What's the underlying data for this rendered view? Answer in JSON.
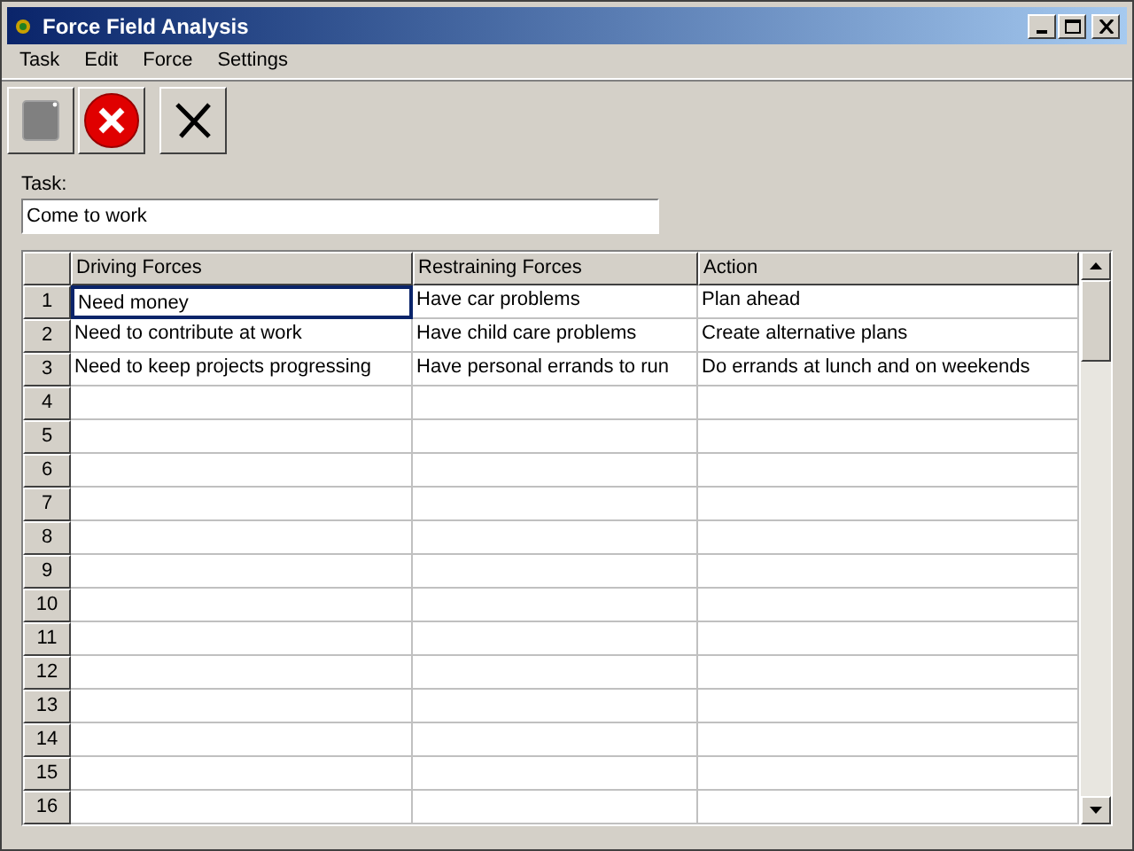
{
  "window": {
    "title": "Force Field Analysis"
  },
  "menu": [
    "Task",
    "Edit",
    "Force",
    "Settings"
  ],
  "task": {
    "label": "Task:",
    "value": "Come to work"
  },
  "table": {
    "columns": [
      "Driving Forces",
      "Restraining Forces",
      "Action"
    ],
    "rows": [
      {
        "number": "1",
        "cells": [
          {
            "text": "Need money",
            "selected": true
          },
          {
            "text": "Have car problems",
            "selected": false
          },
          {
            "text": "Plan ahead",
            "selected": false
          }
        ]
      },
      {
        "number": "2",
        "cells": [
          {
            "text": "Need to contribute at work",
            "selected": false
          },
          {
            "text": "Have child care problems",
            "selected": false
          },
          {
            "text": "Create alternative plans",
            "selected": false
          }
        ]
      },
      {
        "number": "3",
        "cells": [
          {
            "text": "Need to keep projects progressing",
            "selected": false
          },
          {
            "text": "Have personal errands to run",
            "selected": false
          },
          {
            "text": "Do errands at lunch and on weekends",
            "selected": false
          }
        ]
      },
      {
        "number": "4"
      },
      {
        "number": "5"
      },
      {
        "number": "6"
      },
      {
        "number": "7"
      },
      {
        "number": "8"
      },
      {
        "number": "9"
      },
      {
        "number": "10"
      },
      {
        "number": "11"
      },
      {
        "number": "12"
      },
      {
        "number": "13"
      },
      {
        "number": "14"
      },
      {
        "number": "15"
      },
      {
        "number": "16"
      }
    ]
  }
}
